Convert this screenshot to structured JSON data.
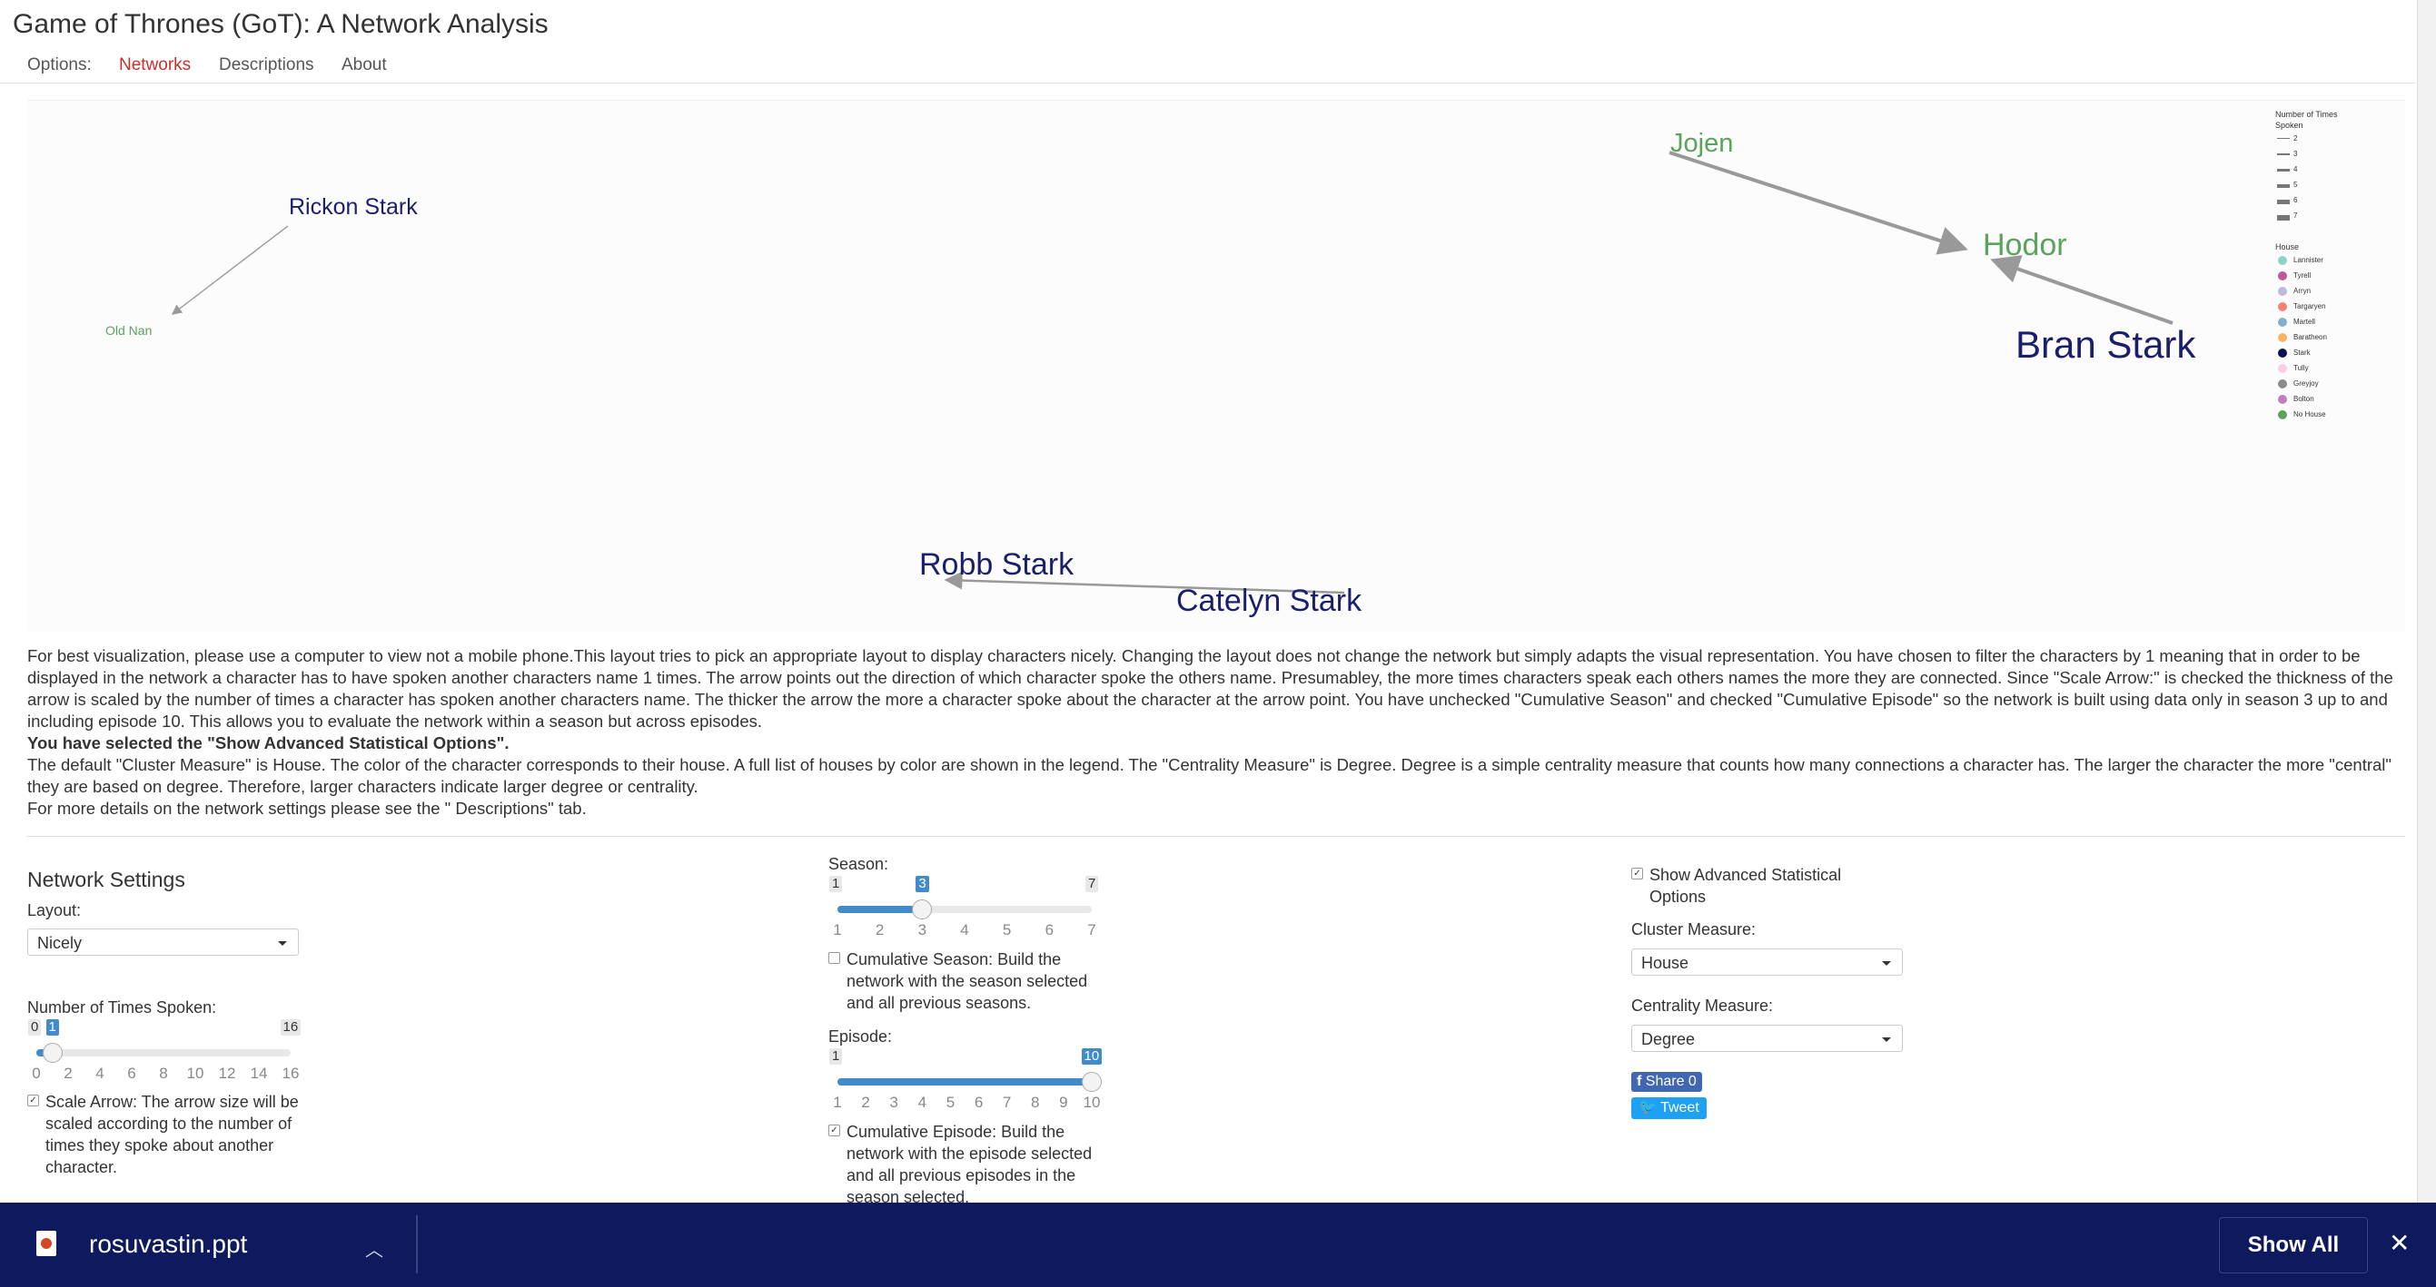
{
  "title": "Game of Thrones (GoT): A Network Analysis",
  "nav": {
    "options": "Options:",
    "networks": "Networks",
    "descriptions": "Descriptions",
    "about": "About"
  },
  "nodes": {
    "rickon": "Rickon Stark",
    "old_nan": "Old Nan",
    "jojen": "Jojen",
    "hodor": "Hodor",
    "bran": "Bran Stark",
    "robb": "Robb Stark",
    "catelyn": "Catelyn Stark"
  },
  "legend": {
    "spoken_title_1": "Number of Times",
    "spoken_title_2": "Spoken",
    "spoken_items": [
      "2",
      "3",
      "4",
      "5",
      "6",
      "7"
    ],
    "house_title": "House",
    "houses": [
      {
        "name": "Lannister",
        "color": "#8dd3c7"
      },
      {
        "name": "Tyrell",
        "color": "#c05a93"
      },
      {
        "name": "Arryn",
        "color": "#bebada"
      },
      {
        "name": "Targaryen",
        "color": "#fb8072"
      },
      {
        "name": "Martell",
        "color": "#80b1d3"
      },
      {
        "name": "Baratheon",
        "color": "#fdb462"
      },
      {
        "name": "Stark",
        "color": "#0b1150"
      },
      {
        "name": "Tully",
        "color": "#fccde5"
      },
      {
        "name": "Greyjoy",
        "color": "#8c8c8c"
      },
      {
        "name": "Bolton",
        "color": "#bc80bd"
      },
      {
        "name": "No House",
        "color": "#5aa35a"
      }
    ]
  },
  "description": {
    "p1": "For best visualization, please use a computer to view not a mobile phone.This layout tries to pick an appropriate layout to display characters nicely. Changing the layout does not change the network but simply adapts the visual representation. You have chosen to filter the characters by 1 meaning that in order to be displayed in the network a character has to have spoken another characters name 1 times. The arrow points out the direction of which character spoke the others name. Presumabley, the more times characters speak each others names the more they are connected. Since \"Scale Arrow:\" is checked the thickness of the arrow is scaled by the number of times a character has spoken another characters name. The thicker the arrow the more a character spoke about the character at the arrow point. You have unchecked \"Cumulative Season\" and checked \"Cumulative Episode\" so the network is built using data only in season 3 up to and including episode 10. This allows you to evaluate the network within a season but across episodes.",
    "advanced_note": "You have selected the \"Show Advanced Statistical Options\".",
    "p2": "The default \"Cluster Measure\" is House. The color of the character corresponds to their house. A full list of houses by color are shown in the legend. The \"Centrality Measure\" is Degree. Degree is a simple centrality measure that counts how many connections a character has. The larger the character the more \"central\" they are based on degree. Therefore, larger characters indicate larger degree or centrality.",
    "p3": "For more details on the network settings please see the \" Descriptions\" tab."
  },
  "settings": {
    "heading": "Network Settings",
    "layout_label": "Layout:",
    "layout_value": "Nicely",
    "spoken_label": "Number of Times Spoken:",
    "spoken_slider": {
      "min": 0,
      "max": 16,
      "value": 1,
      "min_label": "0",
      "value_label": "1",
      "max_label": "16",
      "ticks": [
        "0",
        "2",
        "4",
        "6",
        "8",
        "10",
        "12",
        "14",
        "16"
      ]
    },
    "scale_arrow_text": "Scale Arrow: The arrow size will be scaled according to the number of times they spoke about another character.",
    "season_label": "Season:",
    "season_slider": {
      "min": 1,
      "max": 7,
      "value": 3,
      "min_label": "1",
      "value_label": "3",
      "max_label": "7",
      "ticks": [
        "1",
        "2",
        "3",
        "4",
        "5",
        "6",
        "7"
      ]
    },
    "cumulative_season_text": "Cumulative Season: Build the network with the season selected and all previous seasons.",
    "episode_label": "Episode:",
    "episode_slider": {
      "min": 1,
      "max": 10,
      "value": 10,
      "min_label": "1",
      "value_label": "10",
      "ticks": [
        "1",
        "2",
        "3",
        "4",
        "5",
        "6",
        "7",
        "8",
        "9",
        "10"
      ]
    },
    "cumulative_episode_text": "Cumulative Episode: Build the network with the episode selected and all previous episodes in the season selected.",
    "advanced_text": "Show Advanced Statistical Options",
    "cluster_label": "Cluster Measure:",
    "cluster_value": "House",
    "centrality_label": "Centrality Measure:",
    "centrality_value": "Degree",
    "share_label": "Share 0",
    "tweet_label": "Tweet"
  },
  "download_bar": {
    "file_name": "rosuvastin.ppt",
    "show_all": "Show All"
  }
}
